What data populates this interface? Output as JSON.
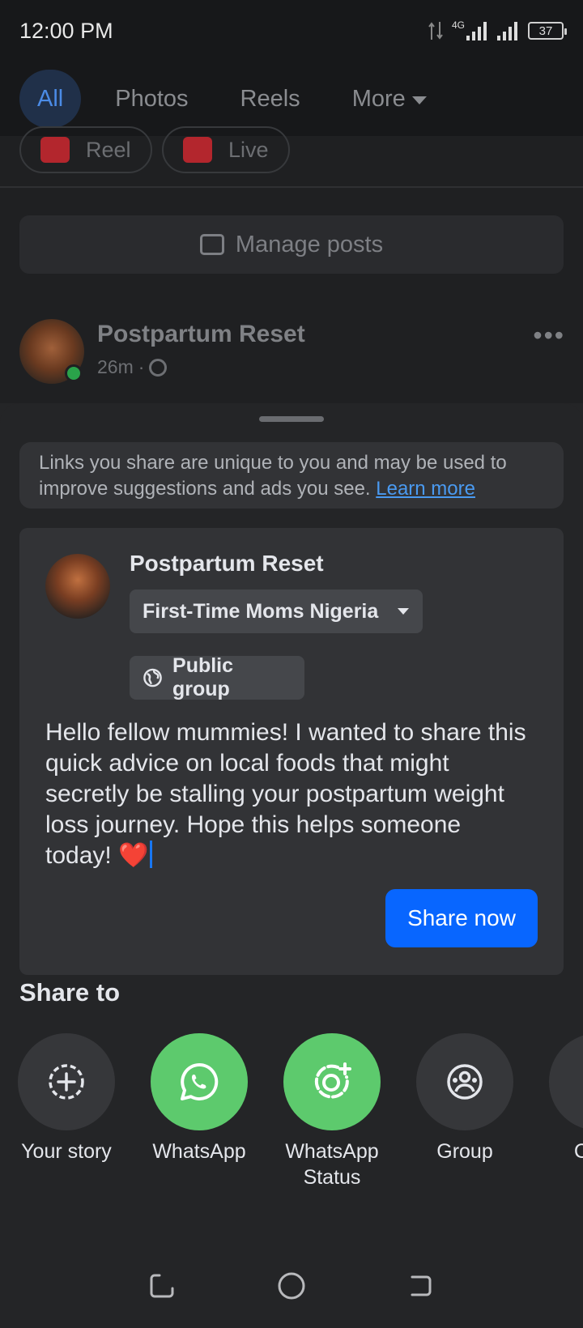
{
  "status_bar": {
    "time": "12:00 PM",
    "network": "4G",
    "battery": "37"
  },
  "tabs": [
    {
      "label": "All",
      "active": true
    },
    {
      "label": "Photos",
      "active": false
    },
    {
      "label": "Reels",
      "active": false
    },
    {
      "label": "More",
      "active": false
    }
  ],
  "feed": {
    "chips": [
      {
        "label": "Reel"
      },
      {
        "label": "Live"
      }
    ],
    "manage_posts": "Manage posts",
    "post_author": "Postpartum Reset",
    "post_time": "26m"
  },
  "share_sheet": {
    "notice_text": "Links you share are unique to you and may be used to improve suggestions and ads you see.",
    "learn_more": "Learn more",
    "composer": {
      "author": "Postpartum Reset",
      "destination": "First-Time Moms Nigeria",
      "privacy": "Public group",
      "message": "Hello fellow mummies! I wanted to share this quick advice on local foods that might secretly be stalling your postpartum weight loss journey. Hope this helps someone today! ❤️",
      "share_button": "Share now"
    },
    "share_to_heading": "Share to",
    "targets": [
      {
        "label": "Your story",
        "icon": "add-story-icon"
      },
      {
        "label": "WhatsApp",
        "icon": "whatsapp-icon"
      },
      {
        "label": "WhatsApp Status",
        "icon": "whatsapp-status-icon"
      },
      {
        "label": "Group",
        "icon": "group-icon"
      },
      {
        "label": "Copy",
        "icon": "copy-link-icon"
      }
    ]
  },
  "colors": {
    "accent": "#0866ff",
    "link": "#4a9af0",
    "whatsapp_green": "#5dca6d",
    "sheet_bg": "#242527"
  }
}
